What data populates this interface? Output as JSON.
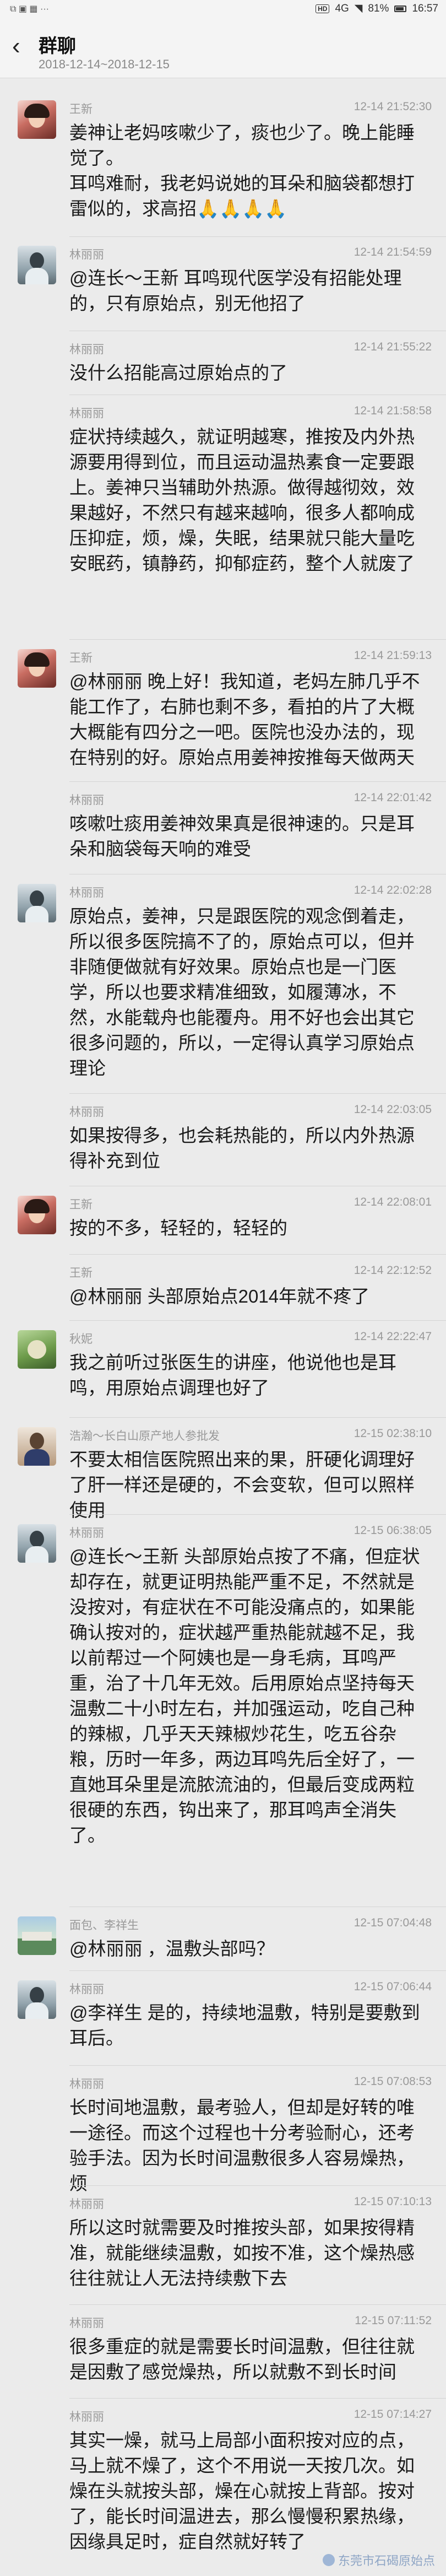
{
  "status_bar": {
    "carrier_icons": "⧉ ▣ ▦ ···",
    "hd": "HD",
    "network": "4G",
    "battery": "81%",
    "clock": "16:57"
  },
  "header": {
    "title": "群聊",
    "date_range": "2018-12-14~2018-12-15"
  },
  "messages": [
    {
      "name": "王新",
      "time": "12-14 21:52:30",
      "text": "姜神让老妈咳嗽少了，痰也少了。晚上能睡觉了。\n耳鸣难耐，我老妈说她的耳朵和脑袋都想打雷似的，求高招🙏🙏🙏🙏"
    },
    {
      "name": "林丽丽",
      "time": "12-14 21:54:59",
      "text": "@连长～王新 耳鸣现代医学没有招能处理的，只有原始点，别无他招了"
    },
    {
      "name": "林丽丽",
      "time": "12-14 21:55:22",
      "text": "没什么招能高过原始点的了"
    },
    {
      "name": "林丽丽",
      "time": "12-14 21:58:58",
      "text": "症状持续越久，就证明越寒，推按及内外热源要用得到位，而且运动温热素食一定要跟上。姜神只当辅助外热源。做得越彻效，效果越好，不然只有越来越响，很多人都响成压抑症，烦，燥，失眠，结果就只能大量吃安眠药，镇静药，抑郁症药，整个人就废了"
    },
    {
      "name": "王新",
      "time": "12-14 21:59:13",
      "text": "@林丽丽 晚上好！我知道，老妈左肺几乎不能工作了，右肺也剩不多，看拍的片了大概大概能有四分之一吧。医院也没办法的，现在特别的好。原始点用姜神按推每天做两天"
    },
    {
      "name": "林丽丽",
      "time": "12-14 22:01:42",
      "text": "咳嗽吐痰用姜神效果真是很神速的。只是耳朵和脑袋每天响的难受"
    },
    {
      "name": "林丽丽",
      "time": "12-14 22:02:28",
      "text": "原始点，姜神，只是跟医院的观念倒着走，所以很多医院搞不了的，原始点可以，但并非随便做就有好效果。原始点也是一门医学，所以也要求精准细致，如履薄冰，不然，水能载舟也能覆舟。用不好也会出其它很多问题的，所以，一定得认真学习原始点理论"
    },
    {
      "name": "林丽丽",
      "time": "12-14 22:03:05",
      "text": "如果按得多，也会耗热能的，所以内外热源得补充到位"
    },
    {
      "name": "王新",
      "time": "12-14 22:08:01",
      "text": "按的不多，轻轻的，轻轻的"
    },
    {
      "name": "王新",
      "time": "12-14 22:12:52",
      "text": "@林丽丽 头部原始点2014年就不疼了"
    },
    {
      "name": "秋妮",
      "time": "12-14 22:22:47",
      "text": "我之前听过张医生的讲座，他说他也是耳鸣，用原始点调理也好了"
    },
    {
      "name": "浩瀚～长白山原产地人参批发",
      "time": "12-15 02:38:10",
      "text": "不要太相信医院照出来的果，肝硬化调理好了肝一样还是硬的，不会变软，但可以照样使用"
    },
    {
      "name": "林丽丽",
      "time": "12-15 06:38:05",
      "text": "@连长～王新 头部原始点按了不痛，但症状却存在，就更证明热能严重不足，不然就是没按对，有症状在不可能没痛点的，如果能确认按对的，症状越严重热能就越不足，我以前帮过一个阿姨也是一身毛病，耳鸣严重，治了十几年无效。后用原始点坚持每天温敷二十小时左右，并加强运动，吃自己种的辣椒，几乎天天辣椒炒花生，吃五谷杂粮，历时一年多，两边耳鸣先后全好了，一直她耳朵里是流脓流油的，但最后变成两粒很硬的东西，钩出来了，那耳鸣声全消失了。"
    },
    {
      "name": "面包、李祥生",
      "time": "12-15 07:04:48",
      "text": "@林丽丽 ，温敷头部吗？"
    },
    {
      "name": "林丽丽",
      "time": "12-15 07:06:44",
      "text": "@李祥生 是的，持续地温敷，特别是要敷到耳后。"
    },
    {
      "name": "林丽丽",
      "time": "12-15 07:08:53",
      "text": "长时间地温敷，最考验人，但却是好转的唯一途径。而这个过程也十分考验耐心，还考验手法。因为长时间温敷很多人容易燥热，烦"
    },
    {
      "name": "林丽丽",
      "time": "12-15 07:10:13",
      "text": "所以这时就需要及时推按头部，如果按得精准，就能继续温敷，如按不准，这个燥热感往往就让人无法持续敷下去"
    },
    {
      "name": "林丽丽",
      "time": "12-15 07:11:52",
      "text": "很多重症的就是需要长时间温敷，但往往就是因敷了感觉燥热，所以就敷不到长时间"
    },
    {
      "name": "林丽丽",
      "time": "12-15 07:14:27",
      "text": "其实一燥，就马上局部小面积按对应的点，马上就不燥了，这个不用说一天按几次。如燥在头就按头部，燥在心就按上背部。按对了，能长时间温进去，那么慢慢积累热缘，因缘具足时，症自然就好转了"
    }
  ],
  "watermark": "东莞市石碣原始点"
}
